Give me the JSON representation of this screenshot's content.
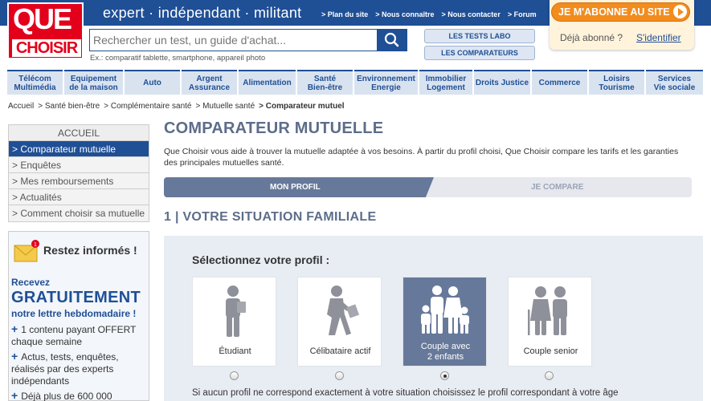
{
  "header": {
    "logo_line1": "QUE",
    "logo_line2": "CHOISIR",
    "tagline": "expert · indépendant · militant",
    "links": [
      "> Plan du site",
      "> Nous connaître",
      "> Nous contacter",
      "> Forum"
    ],
    "search_placeholder": "Rechercher un test, un guide d'achat...",
    "search_hint": "Ex.: comparatif tablette, smartphone, appareil photo",
    "btn_tests": "LES TESTS LABO",
    "btn_comparateurs": "LES COMPARATEURS",
    "subscribe": "JE M'ABONNE AU SITE",
    "already": "Déjà abonné ?",
    "identify": "S'identifier"
  },
  "nav": [
    {
      "label": "Télécom\nMultimédia"
    },
    {
      "label": "Equipement\nde la maison"
    },
    {
      "label": "Auto"
    },
    {
      "label": "Argent\nAssurance"
    },
    {
      "label": "Alimentation"
    },
    {
      "label": "Santé\nBien-être"
    },
    {
      "label": "Environnement\nEnergie"
    },
    {
      "label": "Immobilier\nLogement"
    },
    {
      "label": "Droits Justice"
    },
    {
      "label": "Commerce"
    },
    {
      "label": "Loisirs\nTourisme"
    },
    {
      "label": "Services\nVie sociale"
    }
  ],
  "breadcrumb": [
    "Accueil",
    "> Santé bien-être",
    "> Complémentaire santé",
    "> Mutuelle santé",
    "> Comparateur mutuel"
  ],
  "menu": {
    "head": "ACCUEIL",
    "items": [
      "> Comparateur mutuelle",
      "> Enquêtes",
      "> Mes remboursements",
      "> Actualités",
      "> Comment choisir sa mutuelle"
    ]
  },
  "newsletter": {
    "title": "Restez informés !",
    "r1": "Recevez",
    "r2": "GRATUITEMENT",
    "r3": "notre lettre hebdomadaire !",
    "li1": "1 contenu payant OFFERT chaque semaine",
    "li2": "Actus, tests, enquêtes, réalisés par des experts indépendants",
    "li3": "Déjà plus de 600 000"
  },
  "main": {
    "title": "COMPARATEUR MUTUELLE",
    "intro": "Que Choisir vous aide à trouver la mutuelle adaptée à vos besoins. À partir du profil choisi, Que Choisir compare les tarifs et les garanties des principales mutuelles santé.",
    "step1": "MON PROFIL",
    "step2": "JE COMPARE",
    "section": "1 | VOTRE SITUATION FAMILIALE",
    "select": "Sélectionnez votre profil :",
    "profiles": [
      {
        "label": "Étudiant",
        "selected": false
      },
      {
        "label": "Célibataire actif",
        "selected": false
      },
      {
        "label": "Couple avec\n2 enfants",
        "selected": true
      },
      {
        "label": "Couple senior",
        "selected": false
      }
    ],
    "note": "Si aucun profil ne correspond exactement à votre situation choisissez le profil correspondant à votre âge"
  },
  "colors": {
    "brand_blue": "#1f4f95",
    "brand_red": "#e3001b",
    "accent_orange": "#f28c1e",
    "step_active": "#67799a"
  }
}
